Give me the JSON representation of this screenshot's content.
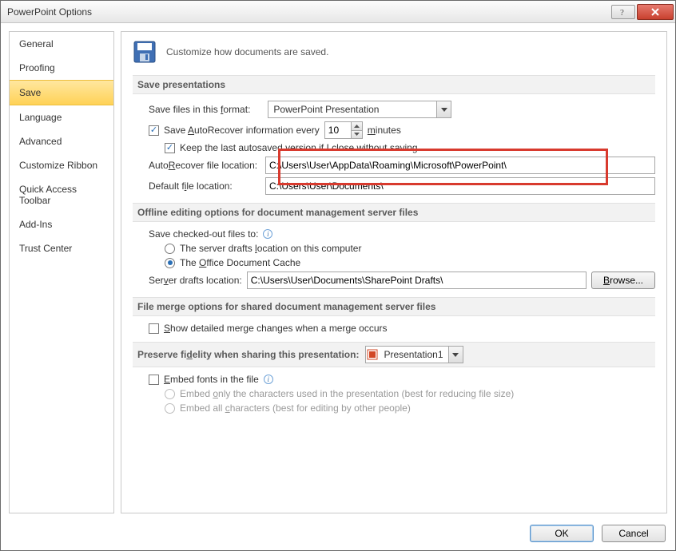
{
  "dialog": {
    "title": "PowerPoint Options"
  },
  "sidebar": {
    "items": [
      {
        "label": "General"
      },
      {
        "label": "Proofing"
      },
      {
        "label": "Save"
      },
      {
        "label": "Language"
      },
      {
        "label": "Advanced"
      },
      {
        "label": "Customize Ribbon"
      },
      {
        "label": "Quick Access Toolbar"
      },
      {
        "label": "Add-Ins"
      },
      {
        "label": "Trust Center"
      }
    ],
    "selected_index": 2
  },
  "header": {
    "text": "Customize how documents are saved."
  },
  "sections": {
    "save_presentations": {
      "title": "Save presentations",
      "format_label_pre": "Save files in this ",
      "format_label_u": "f",
      "format_label_post": "ormat:",
      "format_value": "PowerPoint Presentation",
      "autorecover_pre": "Save ",
      "autorecover_u": "A",
      "autorecover_post": "utoRecover information every",
      "autorecover_value": "10",
      "minutes_u": "m",
      "minutes_post": "inutes",
      "keep_last_label": "Keep the last autosaved version if I close without saving",
      "autorecover_loc_pre": "Auto",
      "autorecover_loc_u": "R",
      "autorecover_loc_post": "ecover file location:",
      "autorecover_loc_value": "C:\\Users\\User\\AppData\\Roaming\\Microsoft\\PowerPoint\\",
      "default_loc_pre": "Default f",
      "default_loc_u": "i",
      "default_loc_post": "le location:",
      "default_loc_value": "C:\\Users\\User\\Documents\\"
    },
    "offline": {
      "title": "Offline editing options for document management server files",
      "save_to_label": "Save checked-out files to:",
      "option1_pre": "The server drafts ",
      "option1_u": "l",
      "option1_post": "ocation on this computer",
      "option2_pre": "The ",
      "option2_u": "O",
      "option2_post": "ffice Document Cache",
      "drafts_label_pre": "Ser",
      "drafts_label_u": "v",
      "drafts_label_post": "er drafts location:",
      "drafts_value": "C:\\Users\\User\\Documents\\SharePoint Drafts\\",
      "browse_u": "B",
      "browse_post": "rowse..."
    },
    "merge": {
      "title": "File merge options for shared document management server files",
      "show_pre": "",
      "show_u": "S",
      "show_post": "how detailed merge changes when a merge occurs"
    },
    "preserve": {
      "title_pre": "Preserve fi",
      "title_u": "d",
      "title_post": "elity when sharing this presentation:",
      "dropdown_value": "Presentation1",
      "embed_u": "E",
      "embed_post": "mbed fonts in the file",
      "embed_only_pre": "Embed ",
      "embed_only_u": "o",
      "embed_only_post": "nly the characters used in the presentation (best for reducing file size)",
      "embed_all_pre": "Embed all ",
      "embed_all_u": "c",
      "embed_all_post": "haracters (best for editing by other people)"
    }
  },
  "buttons": {
    "ok": "OK",
    "cancel": "Cancel"
  }
}
